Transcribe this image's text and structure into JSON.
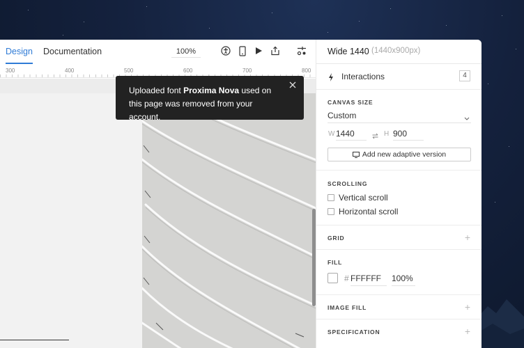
{
  "toolbar": {
    "tabs": [
      {
        "label": "Design",
        "active": true
      },
      {
        "label": "Documentation",
        "active": false
      }
    ],
    "zoom": "100%"
  },
  "ruler": {
    "labels": [
      "300",
      "400",
      "500",
      "600",
      "700",
      "800"
    ]
  },
  "toast": {
    "prefix": "Uploaded font ",
    "font_name": "Proxima Nova",
    "suffix": " used on this page was removed from your account."
  },
  "panel": {
    "title": "Wide 1440",
    "subtitle": "(1440x900px)",
    "interactions": {
      "label": "Interactions",
      "count": "4"
    },
    "canvas_size": {
      "label": "CANVAS SIZE",
      "preset": "Custom",
      "w_label": "W",
      "w_value": "1440",
      "h_label": "H",
      "h_value": "900",
      "adaptive_button": "Add new adaptive version"
    },
    "scrolling": {
      "label": "SCROLLING",
      "vertical": "Vertical scroll",
      "horizontal": "Horizontal scroll"
    },
    "grid": {
      "label": "GRID"
    },
    "fill": {
      "label": "FILL",
      "hash": "#",
      "hex": "FFFFFF",
      "opacity": "100%",
      "color": "#FFFFFF"
    },
    "image_fill": {
      "label": "IMAGE FILL"
    },
    "specification": {
      "label": "SPECIFICATION"
    }
  },
  "colors": {
    "accent": "#2f7bd6",
    "toast_bg": "#222222"
  }
}
